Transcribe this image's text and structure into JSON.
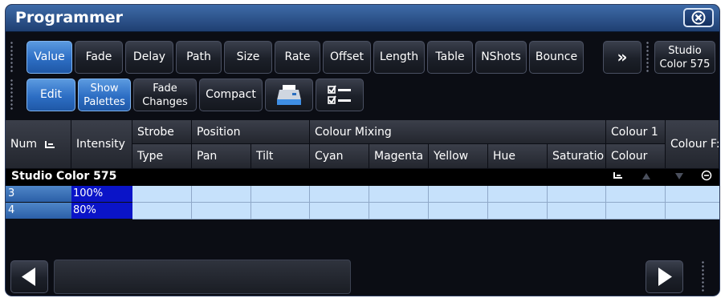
{
  "window": {
    "title": "Programmer"
  },
  "toolbar1": {
    "buttons": [
      "Value",
      "Fade",
      "Delay",
      "Path",
      "Size",
      "Rate",
      "Offset",
      "Length",
      "Table",
      "NShots",
      "Bounce"
    ],
    "more_label": "»",
    "fixture_button": "Studio Color 575"
  },
  "toolbar2": {
    "edit": "Edit",
    "show_palettes": "Show Palettes",
    "fade_changes": "Fade Changes",
    "compact": "Compact"
  },
  "columns": {
    "num": "Num",
    "intensity": "Intensity",
    "strobe": "Strobe",
    "type": "Type",
    "position": "Position",
    "pan": "Pan",
    "tilt": "Tilt",
    "colour_mixing": "Colour Mixing",
    "cyan": "Cyan",
    "magenta": "Magenta",
    "yellow": "Yellow",
    "hue": "Hue",
    "saturation": "Saturatio",
    "colour1": "Colour 1",
    "colour": "Colour",
    "colour_f": "Colour F:"
  },
  "group": {
    "title": "Studio Color 575"
  },
  "rows": [
    {
      "num": "3",
      "intensity": "100%"
    },
    {
      "num": "4",
      "intensity": "80%"
    }
  ],
  "icons": {
    "close": "close-icon",
    "printer": "printer-icon",
    "checklist": "checklist-icon",
    "sort": "sort-icon",
    "up": "arrow-up-icon",
    "down": "arrow-down-icon",
    "remove": "remove-icon",
    "left": "scroll-left-icon",
    "right": "scroll-right-icon"
  },
  "colors": {
    "title_gradient_top": "#3e6ba8",
    "active_button": "#2d6ec4",
    "row_num_fill": "#2b5fa7",
    "intensity_fill": "#0a14c8",
    "cell_fill": "#c6e1fb"
  }
}
